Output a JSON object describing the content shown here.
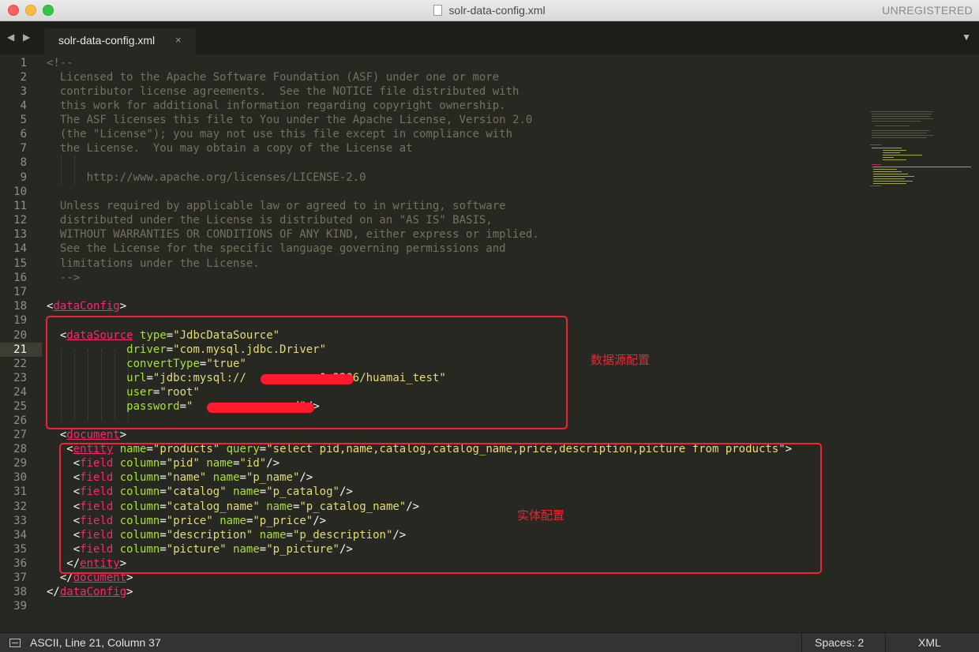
{
  "window": {
    "title": "solr-data-config.xml",
    "registration": "UNREGISTERED"
  },
  "tabbar": {
    "nav_back": "◀",
    "nav_forward": "▶",
    "tab_label": "solr-data-config.xml",
    "tab_close": "×",
    "menu": "▼"
  },
  "editor": {
    "active_line": 21,
    "line_numbers": [
      "1",
      "2",
      "3",
      "4",
      "5",
      "6",
      "7",
      "8",
      "9",
      "10",
      "11",
      "12",
      "13",
      "14",
      "15",
      "16",
      "17",
      "18",
      "19",
      "20",
      "21",
      "22",
      "23",
      "24",
      "25",
      "26",
      "27",
      "28",
      "29",
      "30",
      "31",
      "32",
      "33",
      "34",
      "35",
      "36",
      "37",
      "38",
      "39"
    ],
    "lines": {
      "l1": "<!--",
      "l2": "  Licensed to the Apache Software Foundation (ASF) under one or more",
      "l3": "  contributor license agreements.  See the NOTICE file distributed with",
      "l4": "  this work for additional information regarding copyright ownership.",
      "l5": "  The ASF licenses this file to You under the Apache License, Version 2.0",
      "l6": "  (the \"License\"); you may not use this file except in compliance with",
      "l7": "  the License.  You may obtain a copy of the License at",
      "l9": "      http://www.apache.org/licenses/LICENSE-2.0",
      "l11": "  Unless required by applicable law or agreed to in writing, software",
      "l12": "  distributed under the License is distributed on an \"AS IS\" BASIS,",
      "l13": "  WITHOUT WARRANTIES OR CONDITIONS OF ANY KIND, either express or implied.",
      "l14": "  See the License for the specific language governing permissions and",
      "l15": "  limitations under the License.",
      "l16": "  -->"
    },
    "tags": {
      "dataConfig": "dataConfig",
      "dataSource": "dataSource",
      "document": "document",
      "entity": "entity",
      "field": "field"
    },
    "datasource": {
      "type_attr": "type",
      "type_val": "\"JdbcDataSource\"",
      "driver_attr": "driver",
      "driver_val": "\"com.mysql.jdbc.Driver\"",
      "convertType_attr": "convertType",
      "convertType_val": "\"true\"",
      "url_attr": "url",
      "url_val_start": "\"jdbc:mysql://",
      "url_val_end": "0:3306/huamai_test\"",
      "user_attr": "user",
      "user_val": "\"root\"",
      "password_attr": "password",
      "password_val_start": "\"",
      "password_val_end": "d\""
    },
    "entity": {
      "name_attr": "name",
      "name_val": "\"products\"",
      "query_attr": "query",
      "query_val": "\"select pid,name,catalog,catalog_name,price,description,picture from products\""
    },
    "fields": [
      {
        "column": "\"pid\"",
        "name": "\"id\""
      },
      {
        "column": "\"name\"",
        "name": "\"p_name\""
      },
      {
        "column": "\"catalog\"",
        "name": "\"p_catalog\""
      },
      {
        "column": "\"catalog_name\"",
        "name": "\"p_catalog_name\""
      },
      {
        "column": "\"price\"",
        "name": "\"p_price\""
      },
      {
        "column": "\"description\"",
        "name": "\"p_description\""
      },
      {
        "column": "\"picture\"",
        "name": "\"p_picture\""
      }
    ],
    "field_attrs": {
      "column": "column",
      "name": "name"
    }
  },
  "annotations": {
    "datasource_label": "数据源配置",
    "entity_label": "实体配置",
    "color": "#ee2435"
  },
  "statusbar": {
    "position": "ASCII, Line 21, Column 37",
    "spaces": "Spaces: 2",
    "syntax": "XML"
  },
  "colors": {
    "background": "#272822",
    "comment": "#75715e",
    "tag": "#f92672",
    "attribute": "#a6e22e",
    "string": "#e6db74"
  }
}
